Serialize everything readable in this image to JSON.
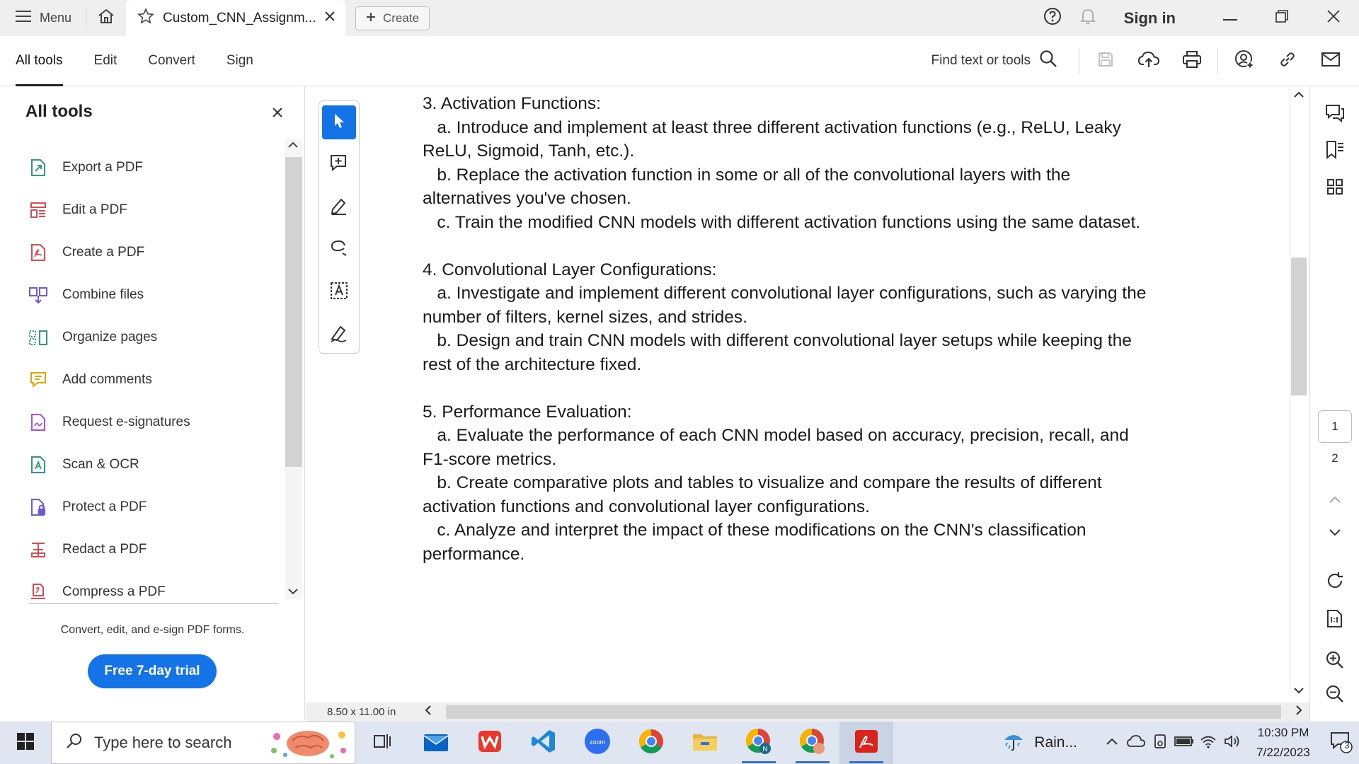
{
  "titlebar": {
    "menu_label": "Menu",
    "tab_title": "Custom_CNN_Assignm...",
    "create_label": "Create",
    "signin_label": "Sign in"
  },
  "toolbar": {
    "tabs": [
      {
        "label": "All tools"
      },
      {
        "label": "Edit"
      },
      {
        "label": "Convert"
      },
      {
        "label": "Sign"
      }
    ],
    "find_label": "Find text or tools"
  },
  "left_panel": {
    "title": "All tools",
    "items": [
      {
        "label": "Export a PDF",
        "icon": "export-pdf-icon",
        "color": "#2d9d78"
      },
      {
        "label": "Edit a PDF",
        "icon": "edit-pdf-icon",
        "color": "#e34850"
      },
      {
        "label": "Create a PDF",
        "icon": "create-pdf-icon",
        "color": "#e34850"
      },
      {
        "label": "Combine files",
        "icon": "combine-files-icon",
        "color": "#6e59d9"
      },
      {
        "label": "Organize pages",
        "icon": "organize-pages-icon",
        "color": "#2d9d78"
      },
      {
        "label": "Add comments",
        "icon": "add-comments-icon",
        "color": "#e6a400"
      },
      {
        "label": "Request e-signatures",
        "icon": "request-esignatures-icon",
        "color": "#b24bdf"
      },
      {
        "label": "Scan & OCR",
        "icon": "scan-ocr-icon",
        "color": "#2d9d78"
      },
      {
        "label": "Protect a PDF",
        "icon": "protect-pdf-icon",
        "color": "#6e59d9"
      },
      {
        "label": "Redact a PDF",
        "icon": "redact-pdf-icon",
        "color": "#e34850"
      },
      {
        "label": "Compress a PDF",
        "icon": "compress-pdf-icon",
        "color": "#e34850"
      }
    ],
    "promo_text": "Convert, edit, and e-sign PDF forms.",
    "trial_button": "Free 7-day trial"
  },
  "document": {
    "lines": [
      "3. Activation Functions:",
      "   a. Introduce and implement at least three different activation functions (e.g., ReLU, Leaky",
      "ReLU, Sigmoid, Tanh, etc.).",
      "   b. Replace the activation function in some or all of the convolutional layers with the",
      "alternatives you've chosen.",
      "   c. Train the modified CNN models with different activation functions using the same dataset.",
      "",
      "4. Convolutional Layer Configurations:",
      "   a. Investigate and implement different convolutional layer configurations, such as varying the",
      "number of filters, kernel sizes, and strides.",
      "   b. Design and train CNN models with different convolutional layer setups while keeping the",
      "rest of the architecture fixed.",
      "",
      "5. Performance Evaluation:",
      "   a. Evaluate the performance of each CNN model based on accuracy, precision, recall, and",
      "F1-score metrics.",
      "   b. Create comparative plots and tables to visualize and compare the results of different",
      "activation functions and convolutional layer configurations.",
      "   c. Analyze and interpret the impact of these modifications on the CNN's classification",
      "performance."
    ],
    "page_size": "8.50 x 11.00 in"
  },
  "right_rail": {
    "current_page": "1",
    "total_pages": "2"
  },
  "taskbar": {
    "search_placeholder": "Type here to search",
    "weather_label": "Rain...",
    "time": "10:30 PM",
    "date": "7/22/2023",
    "notification_count": "3"
  },
  "colors": {
    "accent": "#1473e6",
    "taskbar_bg": "#dfe6f1",
    "titlebar_bg": "#efefef"
  }
}
